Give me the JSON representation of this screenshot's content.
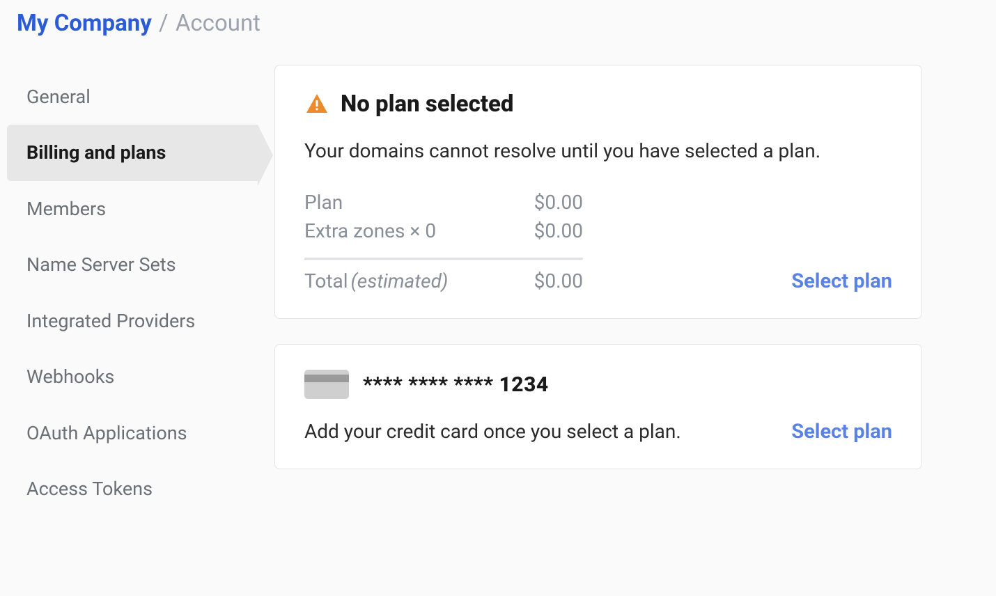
{
  "breadcrumb": {
    "company": "My Company",
    "separator": "/",
    "current": "Account"
  },
  "sidebar": {
    "items": [
      {
        "label": "General",
        "active": false
      },
      {
        "label": "Billing and plans",
        "active": true
      },
      {
        "label": "Members",
        "active": false
      },
      {
        "label": "Name Server Sets",
        "active": false
      },
      {
        "label": "Integrated Providers",
        "active": false
      },
      {
        "label": "Webhooks",
        "active": false
      },
      {
        "label": "OAuth Applications",
        "active": false
      },
      {
        "label": "Access Tokens",
        "active": false
      }
    ]
  },
  "plan_card": {
    "title": "No plan selected",
    "description": "Your domains cannot resolve until you have selected a plan.",
    "rows": [
      {
        "label": "Plan",
        "value": "$0.00"
      },
      {
        "label": "Extra zones × 0",
        "value": "$0.00"
      }
    ],
    "total_label": "Total",
    "total_estimated": "(estimated)",
    "total_value": "$0.00",
    "action": "Select plan"
  },
  "credit_card": {
    "masked_number": "**** **** **** 1234",
    "description": "Add your credit card once you select a plan.",
    "action": "Select plan"
  }
}
